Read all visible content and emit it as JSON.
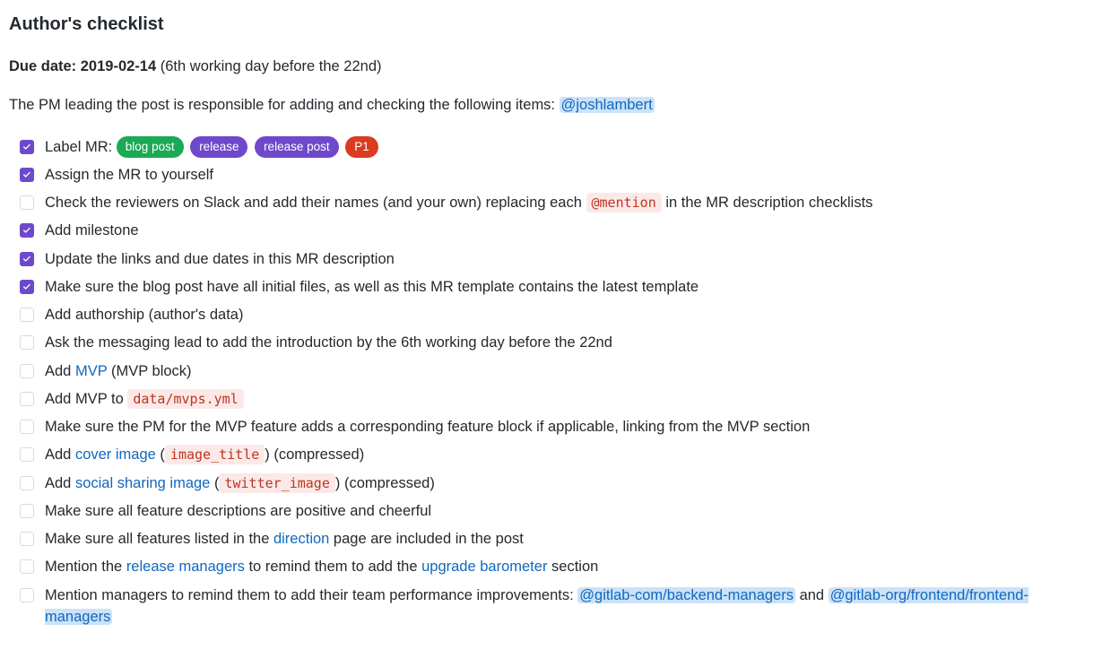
{
  "title": "Author's checklist",
  "due": {
    "label": "Due date: 2019-02-14",
    "note": "(6th working day before the 22nd)"
  },
  "intro": {
    "text": "The PM leading the post is responsible for adding and checking the following items:",
    "mention": "@joshlambert"
  },
  "labelPrefix": "Label MR:",
  "labels": [
    {
      "text": "blog post",
      "color": "green"
    },
    {
      "text": "release",
      "color": "purple"
    },
    {
      "text": "release post",
      "color": "purple"
    },
    {
      "text": "P1",
      "color": "red"
    }
  ],
  "items": {
    "i1": {
      "checked": true,
      "t1": "Assign the MR to yourself"
    },
    "i2": {
      "checked": false,
      "t1": "Check the reviewers on Slack and add their names (and your own) replacing each ",
      "code": "@mention",
      "t2": " in the MR description checklists"
    },
    "i3": {
      "checked": true,
      "t1": "Add milestone"
    },
    "i4": {
      "checked": true,
      "t1": "Update the links and due dates in this MR description"
    },
    "i5": {
      "checked": true,
      "t1": "Make sure the blog post have all initial files, as well as this MR template contains the latest template"
    },
    "i6": {
      "checked": false,
      "t1": "Add authorship (author's data)"
    },
    "i7": {
      "checked": false,
      "t1": "Ask the messaging lead to add the introduction by the 6th working day before the 22nd"
    },
    "i8": {
      "checked": false,
      "t1": "Add ",
      "link": "MVP",
      "t2": " (MVP block)"
    },
    "i9": {
      "checked": false,
      "t1": "Add MVP to ",
      "code": "data/mvps.yml"
    },
    "i10": {
      "checked": false,
      "t1": "Make sure the PM for the MVP feature adds a corresponding feature block if applicable, linking from the MVP section"
    },
    "i11": {
      "checked": false,
      "t1": "Add ",
      "link": "cover image",
      "t2": " (",
      "code": "image_title",
      "t3": ") (compressed)"
    },
    "i12": {
      "checked": false,
      "t1": "Add ",
      "link": "social sharing image",
      "t2": " (",
      "code": "twitter_image",
      "t3": ") (compressed)"
    },
    "i13": {
      "checked": false,
      "t1": "Make sure all feature descriptions are positive and cheerful"
    },
    "i14": {
      "checked": false,
      "t1": "Make sure all features listed in the ",
      "link": "direction",
      "t2": " page are included in the post"
    },
    "i15": {
      "checked": false,
      "t1": "Mention the ",
      "link": "release managers",
      "t2": " to remind them to add the ",
      "link2": "upgrade barometer",
      "t3": " section"
    },
    "i16": {
      "checked": false,
      "t1": "Mention managers to remind them to add their team performance improvements: ",
      "m1": "@gitlab-com/backend-managers",
      "t2": " and ",
      "m2": "@gitlab-org/frontend/frontend-managers"
    }
  }
}
